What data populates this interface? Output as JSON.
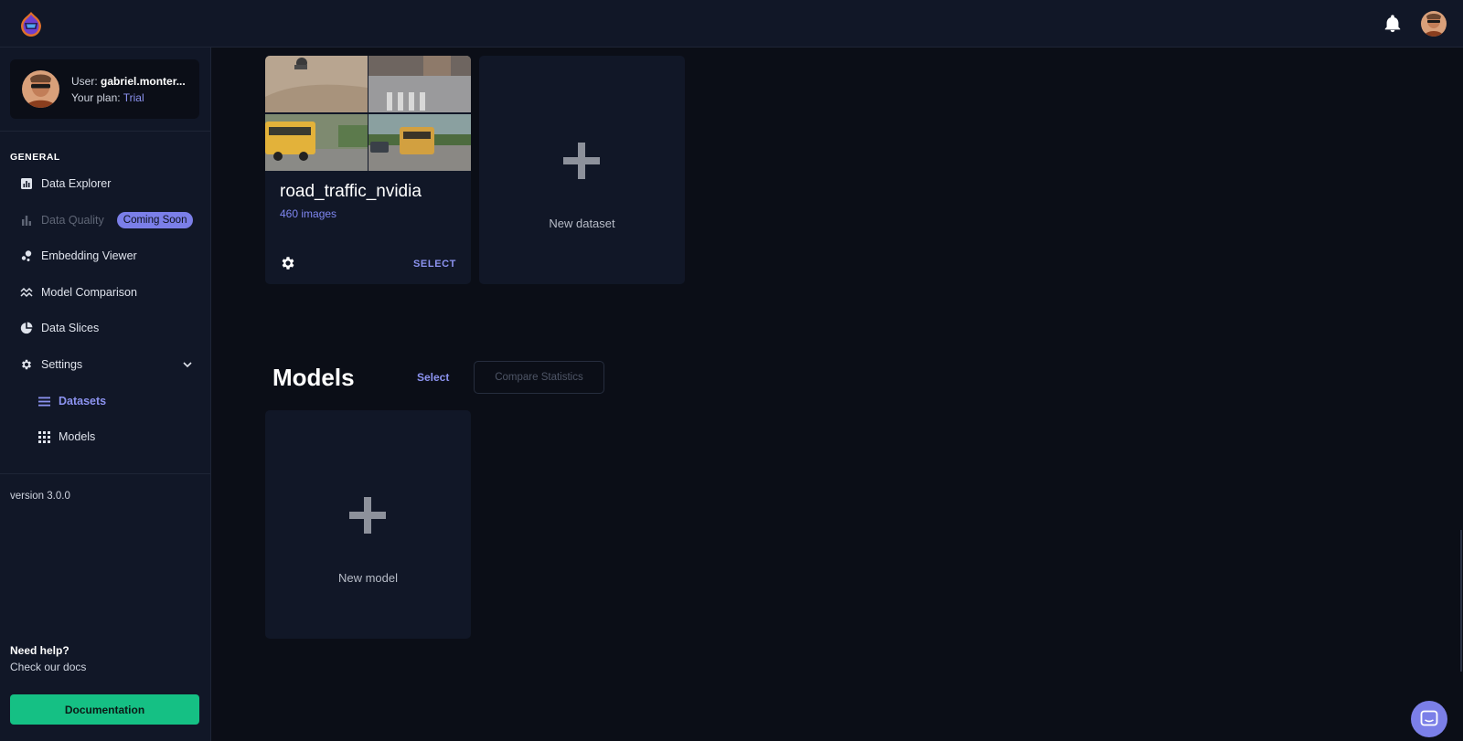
{
  "app": {
    "logo_icon": "helmet-logo-icon",
    "notifications_icon": "bell-icon"
  },
  "user": {
    "label_prefix": "User:",
    "name": "gabriel.monter...",
    "plan_prefix": "Your plan:",
    "plan": "Trial"
  },
  "sidebar": {
    "section": "GENERAL",
    "items": [
      {
        "label": "Data Explorer",
        "icon": "bar-chart-icon",
        "disabled": false
      },
      {
        "label": "Data Quality",
        "icon": "column-chart-icon",
        "disabled": true,
        "badge": "Coming Soon"
      },
      {
        "label": "Embedding Viewer",
        "icon": "scatter-dots-icon",
        "disabled": false
      },
      {
        "label": "Model Comparison",
        "icon": "line-wave-icon",
        "disabled": false
      },
      {
        "label": "Data Slices",
        "icon": "pie-chart-icon",
        "disabled": false
      },
      {
        "label": "Settings",
        "icon": "gear-icon",
        "disabled": false,
        "expanded": true
      }
    ],
    "sub_items": [
      {
        "label": "Datasets",
        "icon": "list-icon",
        "active": true
      },
      {
        "label": "Models",
        "icon": "grid-icon",
        "active": false
      }
    ],
    "version": "version 3.0.0",
    "help_title": "Need help?",
    "help_subtitle": "Check our docs",
    "documentation_button": "Documentation"
  },
  "datasets": {
    "cards": [
      {
        "name": "road_traffic_nvidia",
        "count": "460 images",
        "select_label": "SELECT"
      }
    ],
    "new_label": "New dataset"
  },
  "models": {
    "title": "Models",
    "select_label": "Select",
    "compare_label": "Compare Statistics",
    "new_label": "New model"
  },
  "colors": {
    "accent": "#8c93f0",
    "badge": "#7b7fe8",
    "documentation_button": "#15c084",
    "background": "#0b0e17",
    "panel": "#111727"
  }
}
